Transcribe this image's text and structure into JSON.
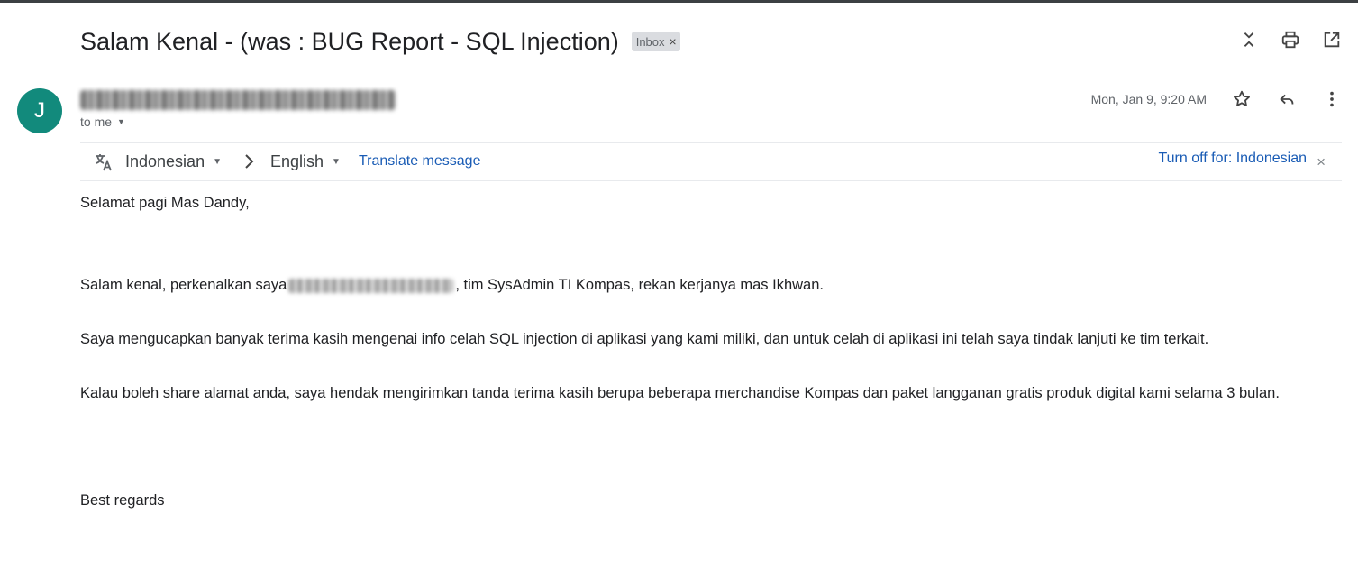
{
  "email": {
    "subject": "Salam Kenal - (was : BUG Report - SQL Injection)",
    "label": "Inbox",
    "label_remove": "×",
    "avatar_letter": "J",
    "to": "to me",
    "date": "Mon, Jan 9, 9:20 AM",
    "header_icons": [
      "expand-collapse-icon",
      "print-icon",
      "open-new-window-icon"
    ],
    "message_icons": [
      "star-icon",
      "reply-icon",
      "more-vert-icon"
    ]
  },
  "translate": {
    "source_lang": "Indonesian",
    "target_lang": "English",
    "translate_link": "Translate message",
    "turn_off": "Turn off for: Indonesian",
    "close": "×"
  },
  "body": {
    "greeting": "Selamat pagi Mas Dandy,",
    "p1_before": "Salam kenal, perkenalkan saya",
    "p1_after": ", tim SysAdmin TI Kompas, rekan kerjanya mas Ikhwan.",
    "p2": "Saya mengucapkan banyak terima kasih mengenai info celah SQL injection di aplikasi yang kami miliki, dan untuk celah di aplikasi ini telah saya tindak lanjuti ke tim terkait.",
    "p3": "Kalau boleh share alamat anda, saya hendak mengirimkan tanda terima kasih berupa beberapa merchandise Kompas dan paket langganan gratis produk digital kami selama 3 bulan.",
    "closing": "Best regards"
  }
}
